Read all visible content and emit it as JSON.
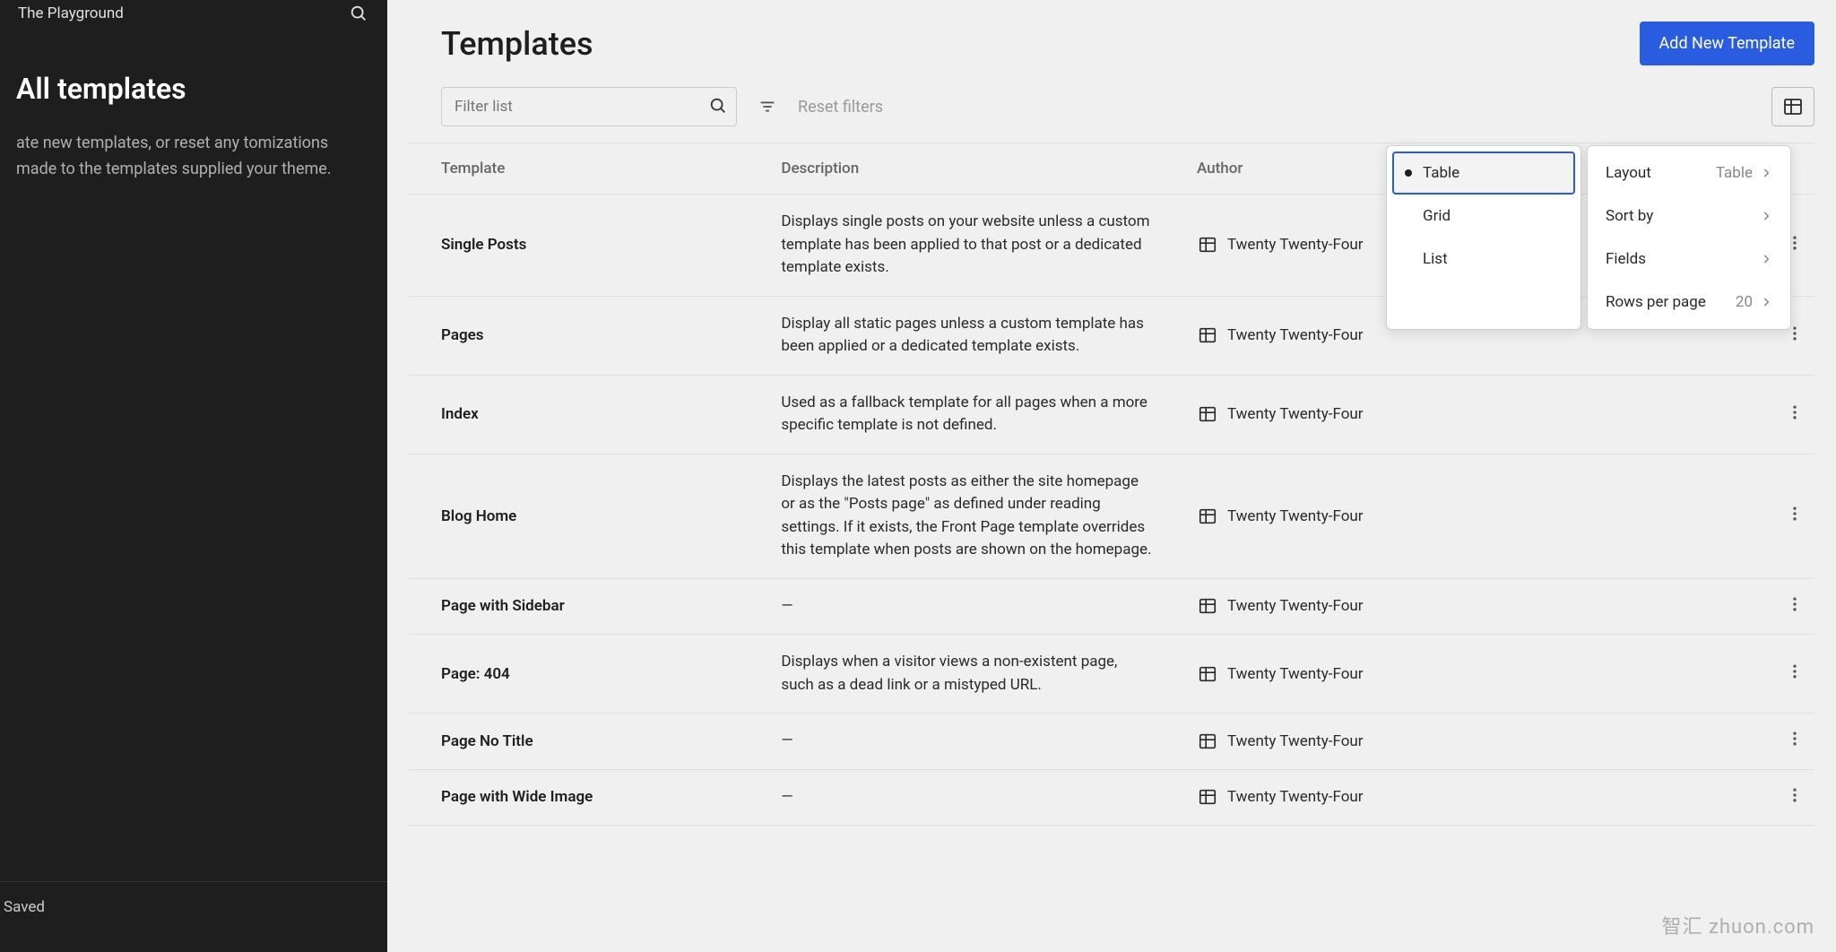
{
  "sidebar": {
    "site_title": "The Playground",
    "heading": "All templates",
    "description": "ate new templates, or reset any tomizations made to the templates supplied your theme.",
    "footer_status": "Saved"
  },
  "header": {
    "title": "Templates",
    "add_button": "Add New Template"
  },
  "toolbar": {
    "filter_placeholder": "Filter list",
    "reset_filters": "Reset filters"
  },
  "columns": {
    "template": "Template",
    "description": "Description",
    "author": "Author"
  },
  "rows": [
    {
      "name": "Single Posts",
      "description": "Displays single posts on your website unless a custom template has been applied to that post or a dedicated template exists.",
      "author": "Twenty Twenty-Four"
    },
    {
      "name": "Pages",
      "description": "Display all static pages unless a custom template has been applied or a dedicated template exists.",
      "author": "Twenty Twenty-Four"
    },
    {
      "name": "Index",
      "description": "Used as a fallback template for all pages when a more specific template is not defined.",
      "author": "Twenty Twenty-Four"
    },
    {
      "name": "Blog Home",
      "description": "Displays the latest posts as either the site homepage or as the \"Posts page\" as defined under reading settings. If it exists, the Front Page template overrides this template when posts are shown on the homepage.",
      "author": "Twenty Twenty-Four"
    },
    {
      "name": "Page with Sidebar",
      "description": "—",
      "author": "Twenty Twenty-Four"
    },
    {
      "name": "Page: 404",
      "description": "Displays when a visitor views a non-existent page, such as a dead link or a mistyped URL.",
      "author": "Twenty Twenty-Four"
    },
    {
      "name": "Page No Title",
      "description": "—",
      "author": "Twenty Twenty-Four"
    },
    {
      "name": "Page with Wide Image",
      "description": "—",
      "author": "Twenty Twenty-Four"
    }
  ],
  "layout_menu": {
    "table": "Table",
    "grid": "Grid",
    "list": "List"
  },
  "settings_menu": {
    "layout_label": "Layout",
    "layout_value": "Table",
    "sort_by": "Sort by",
    "fields": "Fields",
    "rows_label": "Rows per page",
    "rows_value": "20"
  },
  "watermark": "智汇 zhuon.com"
}
